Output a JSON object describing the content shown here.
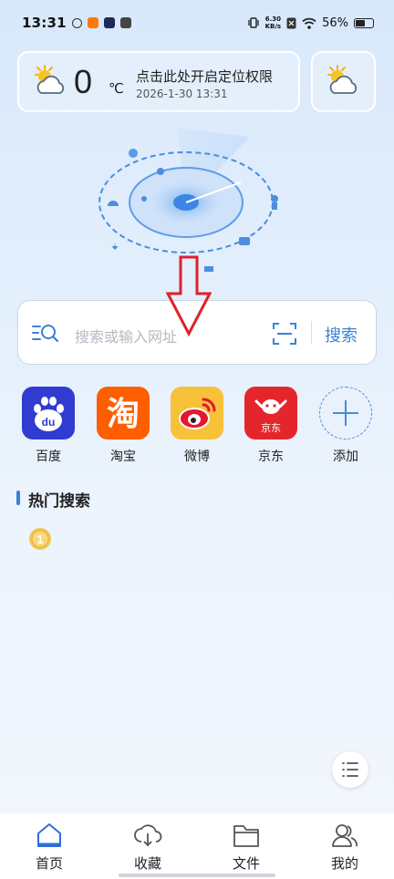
{
  "status_bar": {
    "time": "13:31",
    "net_speed_value": "6.30",
    "net_speed_unit": "KB/s",
    "battery": "56%"
  },
  "weather": {
    "temperature": "0",
    "unit": "℃",
    "location_prompt": "点击此处开启定位权限",
    "datetime": "2026-1-30 13:31",
    "icon": "partly-cloudy-icon"
  },
  "search": {
    "placeholder": "搜索或输入网址",
    "button_label": "搜索"
  },
  "shortcuts": [
    {
      "label": "百度",
      "icon": "baidu-icon",
      "color": "#2f3bd1"
    },
    {
      "label": "淘宝",
      "icon": "taobao-icon",
      "color": "#ff5e00"
    },
    {
      "label": "微博",
      "icon": "weibo-icon",
      "color": "#f8c13a"
    },
    {
      "label": "京东",
      "icon": "jd-icon",
      "color": "#e4262c"
    },
    {
      "label": "添加",
      "icon": "add-icon",
      "color": "#4d8ad0"
    }
  ],
  "hot_search": {
    "title": "热门搜索",
    "ranks": [
      "1"
    ]
  },
  "bottom_nav": [
    {
      "label": "首页",
      "icon": "home-icon",
      "active": true
    },
    {
      "label": "收藏",
      "icon": "cloud-download-icon"
    },
    {
      "label": "文件",
      "icon": "folder-icon"
    },
    {
      "label": "我的",
      "icon": "users-icon"
    }
  ],
  "colors": {
    "accent": "#3a82d6",
    "arrow": "#e0202a"
  }
}
